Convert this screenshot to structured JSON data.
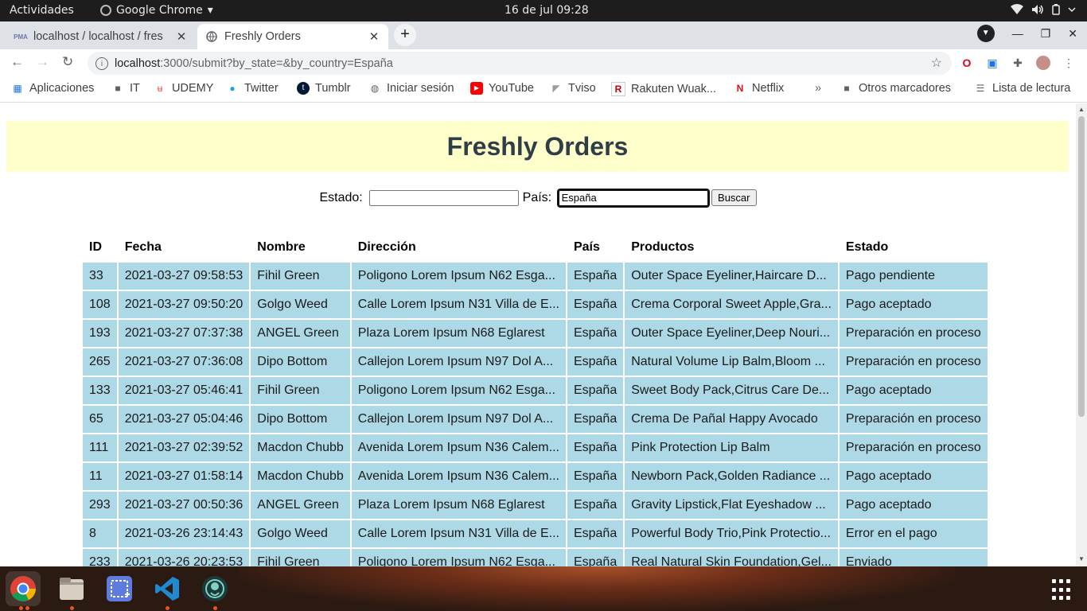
{
  "system": {
    "activities": "Actividades",
    "app_name": "Google Chrome",
    "app_menu_arrow": "▾",
    "clock": "16 de jul  09:28"
  },
  "tabs": [
    {
      "title": "localhost / localhost / fres",
      "favicon": "PMA",
      "close": "✕"
    },
    {
      "title": "Freshly Orders",
      "close": "✕"
    }
  ],
  "address": {
    "host": "localhost",
    "rest": ":3000/submit?by_state=&by_country=España"
  },
  "bookmarks": [
    {
      "label": "Aplicaciones",
      "icon": "apps-grid-icon"
    },
    {
      "label": "IT",
      "icon": "folder-icon"
    },
    {
      "label": "UDEMY",
      "icon": "udemy-icon"
    },
    {
      "label": "Twitter",
      "icon": "twitter-icon"
    },
    {
      "label": "Tumblr",
      "icon": "tumblr-icon"
    },
    {
      "label": "Iniciar sesión",
      "icon": "globe-icon"
    },
    {
      "label": "YouTube",
      "icon": "youtube-icon"
    },
    {
      "label": "Tviso",
      "icon": "tviso-icon"
    },
    {
      "label": "Rakuten Wuak...",
      "icon": "rakuten-icon"
    },
    {
      "label": "Netflix",
      "icon": "netflix-icon"
    },
    {
      "label": "»",
      "icon": "overflow-chevron"
    },
    {
      "label": "Otros marcadores",
      "icon": "folder-icon"
    },
    {
      "label": "Lista de lectura",
      "icon": "reading-list-icon"
    }
  ],
  "page": {
    "title": "Freshly Orders",
    "form": {
      "state_label": "Estado:",
      "state_value": "",
      "country_label": "País:",
      "country_value": "España",
      "submit_label": "Buscar"
    },
    "table": {
      "columns": [
        "ID",
        "Fecha",
        "Nombre",
        "Dirección",
        "País",
        "Productos",
        "Estado"
      ],
      "rows": [
        [
          "33",
          "2021-03-27 09:58:53",
          "Fihil Green",
          "Poligono Lorem Ipsum N62 Esga...",
          "España",
          "Outer Space Eyeliner,Haircare D...",
          "Pago pendiente"
        ],
        [
          "108",
          "2021-03-27 09:50:20",
          "Golgo Weed",
          "Calle Lorem Ipsum N31 Villa de E...",
          "España",
          "Crema Corporal Sweet Apple,Gra...",
          "Pago aceptado"
        ],
        [
          "193",
          "2021-03-27 07:37:38",
          "ANGEL Green",
          "Plaza Lorem Ipsum N68 Eglarest",
          "España",
          "Outer Space Eyeliner,Deep Nouri...",
          "Preparación en proceso"
        ],
        [
          "265",
          "2021-03-27 07:36:08",
          "Dipo Bottom",
          "Callejon Lorem Ipsum N97 Dol A...",
          "España",
          "Natural Volume Lip Balm,Bloom ...",
          "Preparación en proceso"
        ],
        [
          "133",
          "2021-03-27 05:46:41",
          "Fihil Green",
          "Poligono Lorem Ipsum N62 Esga...",
          "España",
          "Sweet Body Pack,Citrus Care De...",
          "Pago aceptado"
        ],
        [
          "65",
          "2021-03-27 05:04:46",
          "Dipo Bottom",
          "Callejon Lorem Ipsum N97 Dol A...",
          "España",
          "Crema De Pañal Happy Avocado",
          "Preparación en proceso"
        ],
        [
          "111",
          "2021-03-27 02:39:52",
          "Macdon Chubb",
          "Avenida Lorem Ipsum N36 Calem...",
          "España",
          "Pink Protection Lip Balm",
          "Preparación en proceso"
        ],
        [
          "11",
          "2021-03-27 01:58:14",
          "Macdon Chubb",
          "Avenida Lorem Ipsum N36 Calem...",
          "España",
          "Newborn Pack,Golden Radiance ...",
          "Pago aceptado"
        ],
        [
          "293",
          "2021-03-27 00:50:36",
          "ANGEL Green",
          "Plaza Lorem Ipsum N68 Eglarest",
          "España",
          "Gravity Lipstick,Flat Eyeshadow ...",
          "Pago aceptado"
        ],
        [
          "8",
          "2021-03-26 23:14:43",
          "Golgo Weed",
          "Calle Lorem Ipsum N31 Villa de E...",
          "España",
          "Powerful Body Trio,Pink Protectio...",
          "Error en el pago"
        ],
        [
          "233",
          "2021-03-26 20:23:53",
          "Fihil Green",
          "Poligono Lorem Ipsum N62 Esga...",
          "España",
          "Real Natural Skin Foundation,Gel...",
          "Enviado"
        ]
      ]
    }
  },
  "dock": [
    {
      "name": "chrome-dock-icon",
      "running": true,
      "active": true
    },
    {
      "name": "files-dock-icon",
      "running": true
    },
    {
      "name": "screenshot-dock-icon",
      "running": false
    },
    {
      "name": "vscode-dock-icon",
      "running": true
    },
    {
      "name": "gitkraken-dock-icon",
      "running": true
    }
  ],
  "colors": {
    "banner_bg": "#ffffcc",
    "title_text": "#2f3e46",
    "row_bg": "#add8e6",
    "tabstrip_bg": "#dee1e6",
    "topbar_bg": "#1d1d1d",
    "dock_running_dot": "#e95420"
  }
}
